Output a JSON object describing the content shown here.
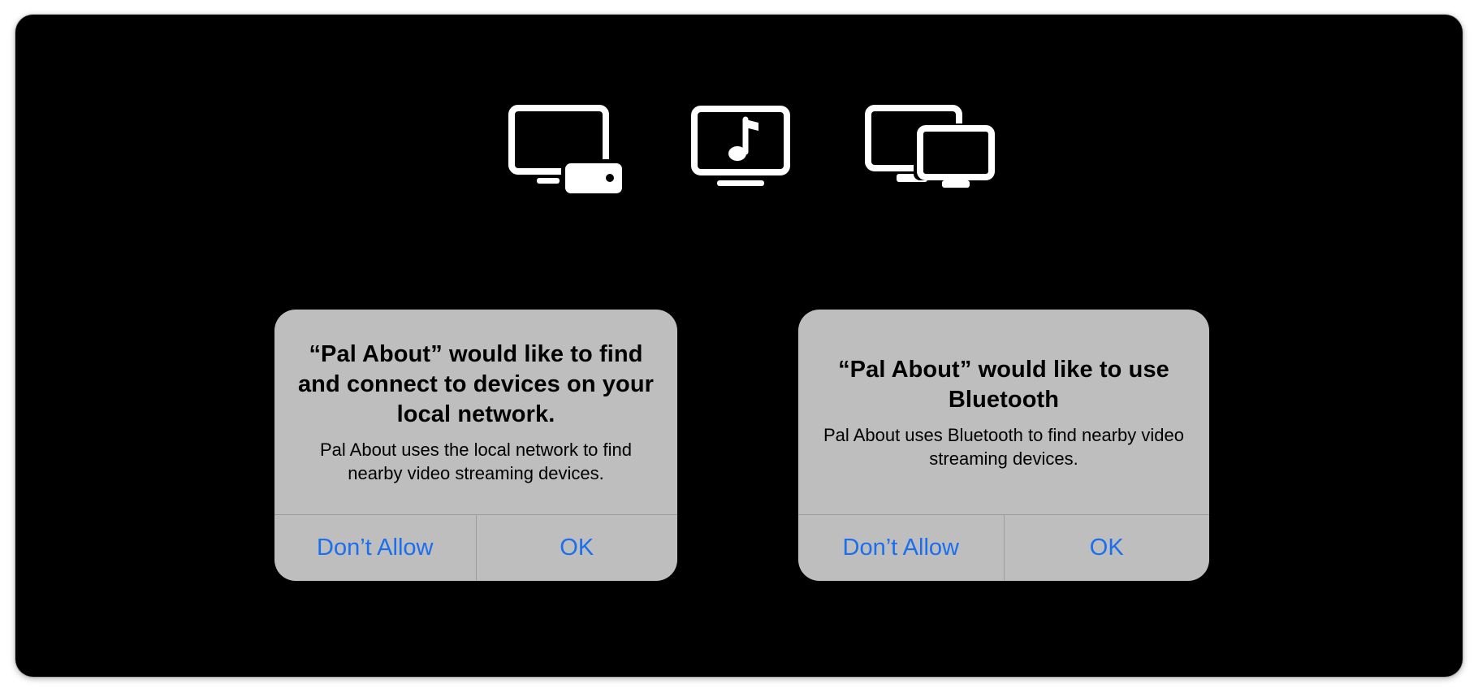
{
  "colors": {
    "background": "#000000",
    "alert_bg": "#bdbebd",
    "button_text": "#1a6ef0",
    "icon": "#ffffff"
  },
  "icons": {
    "left": "apple-tv-icon",
    "center": "music-tv-icon",
    "right": "multiple-displays-icon"
  },
  "alerts": [
    {
      "title": "“Pal About” would like to find and connect to devices on your local network.",
      "message": "Pal About uses the local network to find nearby video streaming devices.",
      "buttons": {
        "deny": "Don’t Allow",
        "ok": "OK"
      }
    },
    {
      "title": "“Pal About” would like to use Bluetooth",
      "message": "Pal About uses Bluetooth to find nearby video streaming devices.",
      "buttons": {
        "deny": "Don’t Allow",
        "ok": "OK"
      }
    }
  ]
}
